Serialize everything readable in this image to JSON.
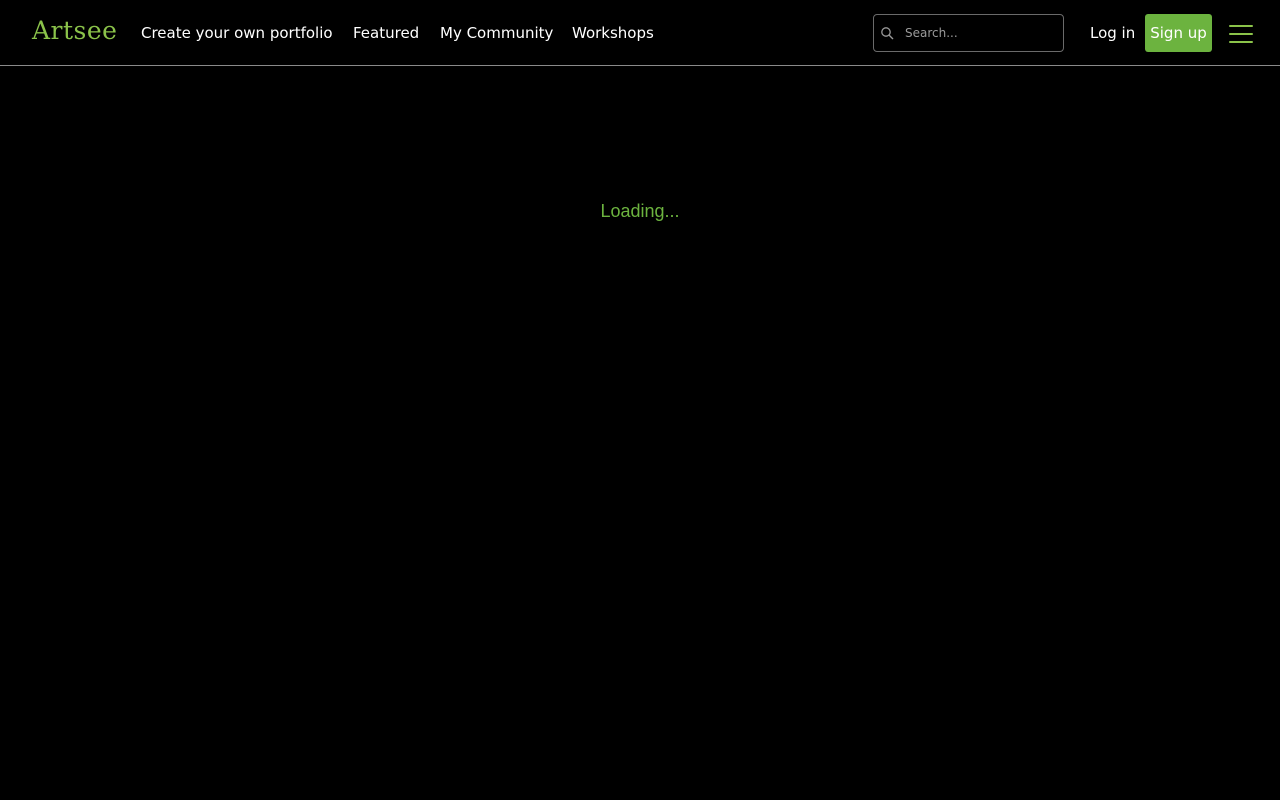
{
  "brand": {
    "name": "Artsee",
    "color": "#8bc34a"
  },
  "nav": {
    "items": [
      {
        "label": "Create your own portfolio"
      },
      {
        "label": "Featured"
      },
      {
        "label": "My Community"
      },
      {
        "label": "Workshops"
      }
    ]
  },
  "search": {
    "placeholder": "Search...",
    "value": "",
    "icon": "search-icon"
  },
  "auth": {
    "login_label": "Log in",
    "signup_label": "Sign up",
    "signup_color": "#6cb33f"
  },
  "menu": {
    "icon": "hamburger-menu-icon"
  },
  "main": {
    "loading_text": "Loading...",
    "loading_color": "#6cb33f"
  }
}
